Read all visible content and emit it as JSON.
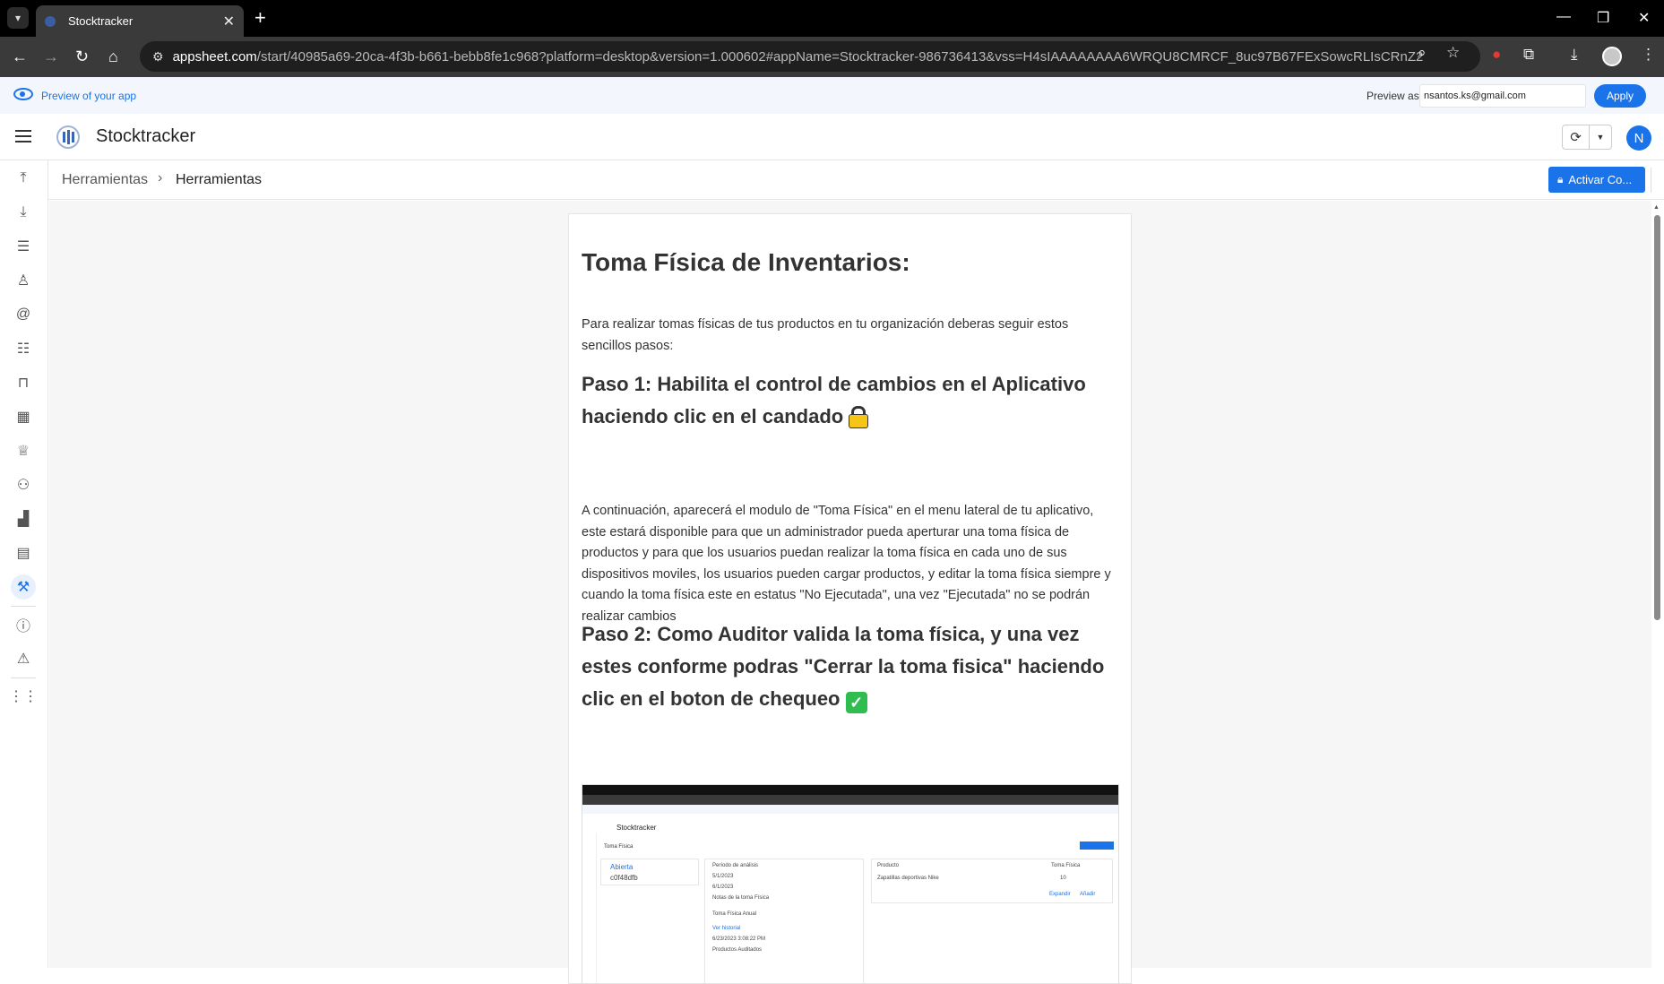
{
  "browser": {
    "tab_title": "Stocktracker",
    "url_host": "appsheet.com",
    "url_rest": "/start/40985a69-20ca-4f3b-b661-bebb8fe1c968?platform=desktop&version=1.000602#appName=Stocktracker-986736413&vss=H4sIAAAAAAAA6WRQU8CMRCF_8uc97B67FExSowcRLIsCRnZ2aSx227aqUg2..."
  },
  "preview": {
    "label": "Preview of your app",
    "preview_as_label": "Preview as:",
    "email": "nsantos.ks@gmail.com",
    "apply_label": "Apply"
  },
  "app": {
    "name": "Stocktracker",
    "user_initial": "N"
  },
  "breadcrumb": {
    "parent": "Herramientas",
    "current": "Herramientas",
    "action_label": "Activar Co..."
  },
  "sidebar": {
    "items": [
      "upload-icon",
      "download-icon",
      "list-icon",
      "person-icon",
      "at-icon",
      "catalog-icon",
      "bag-icon",
      "warehouse-icon",
      "trophy-icon",
      "group-icon",
      "analytics-icon",
      "report-icon",
      "tools-icon",
      "info-icon",
      "feedback-icon",
      "apps-icon"
    ]
  },
  "article": {
    "title": "Toma Física de Inventarios:",
    "intro": "Para realizar tomas físicas de tus productos en tu organización deberas seguir estos sencillos pasos:",
    "step1": "Paso 1: Habilita el control de cambios en el Aplicativo haciendo clic en el candado",
    "step1_body": "A continuación, aparecerá el modulo de \"Toma Física\" en el menu lateral de tu aplicativo, este estará disponible para que un administrador pueda aperturar una toma física de productos y para que los usuarios puedan realizar la toma física en cada uno de sus dispositivos moviles, los usuarios pueden cargar productos, y editar la toma física siempre y cuando la toma física este en estatus \"No Ejecutada\", una vez \"Ejecutada\" no se podrán realizar cambios",
    "step2": "Paso 2: Como Auditor valida la toma física, y una vez estes conforme podras \"Cerrar la toma fisica\" haciendo clic en el boton de chequeo"
  },
  "embedded_screenshot": {
    "app_name": "Stocktracker",
    "crumb": "Toma Física",
    "status": "Abierta",
    "record_id": "c0f48dfb",
    "field1": "Período de análisis",
    "date1": "5/1/2023",
    "date2": "6/1/2023",
    "field2": "Notas de la toma Física",
    "note": "Toma Física Anual",
    "edit_link": "Ver historial",
    "timestamp": "6/23/2023 3:08:22 PM",
    "field3": "Productos Auditados",
    "col1": "Producto",
    "col2": "Toma Física",
    "row_product": "Zapatillas deportivas Nike",
    "row_value": "10",
    "link1": "Expandir",
    "link2": "Añadir"
  }
}
